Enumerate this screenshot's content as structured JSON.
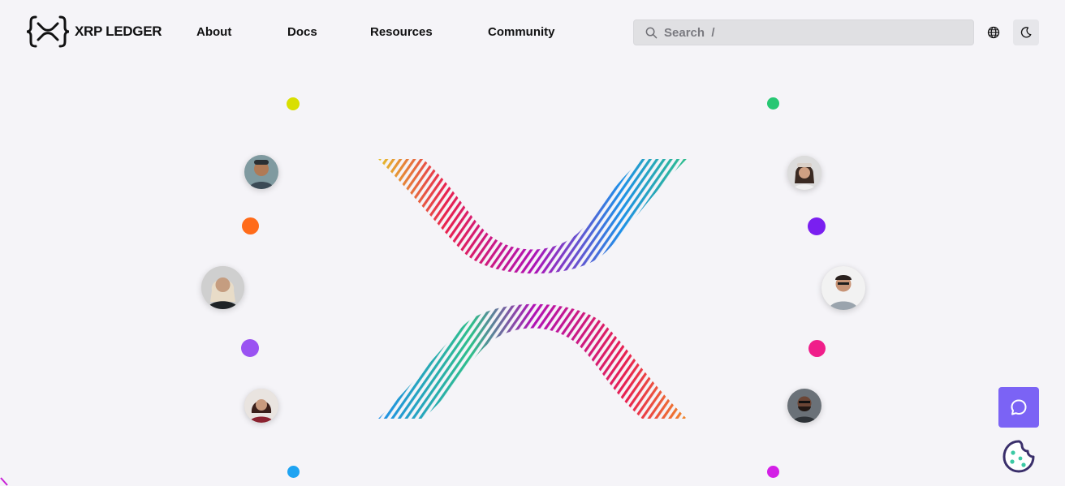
{
  "header": {
    "logo_text": "XRP LEDGER",
    "logo_icon": "xrp-x-braces-logo",
    "nav": [
      {
        "label": "About"
      },
      {
        "label": "Docs"
      },
      {
        "label": "Resources"
      },
      {
        "label": "Community"
      }
    ],
    "search": {
      "placeholder": "Search  /",
      "value": "",
      "icon": "search-icon"
    },
    "language_icon": "globe-icon",
    "theme_icon": "moon-icon"
  },
  "hero": {
    "graphic": "xrp-x-striped-gradient",
    "dot_colors": {
      "yellow": "#d9df00",
      "orange": "#ff6b1a",
      "purple_light": "#9a52f2",
      "blue": "#1ea3f2",
      "green": "#27c773",
      "violet": "#7a1ff0",
      "pink": "#f01e8a",
      "magenta": "#d31fe6"
    },
    "gradient_colors": {
      "yellow": "#e5c02a",
      "red": "#e8214f",
      "magenta": "#b012b5",
      "blue": "#1f8fe8",
      "green": "#2fbf8a"
    }
  },
  "widgets": {
    "chat_icon": "chat-bubble-icon",
    "chat_color": "#7b63f5",
    "cookie_icon": "cookie-icon"
  }
}
